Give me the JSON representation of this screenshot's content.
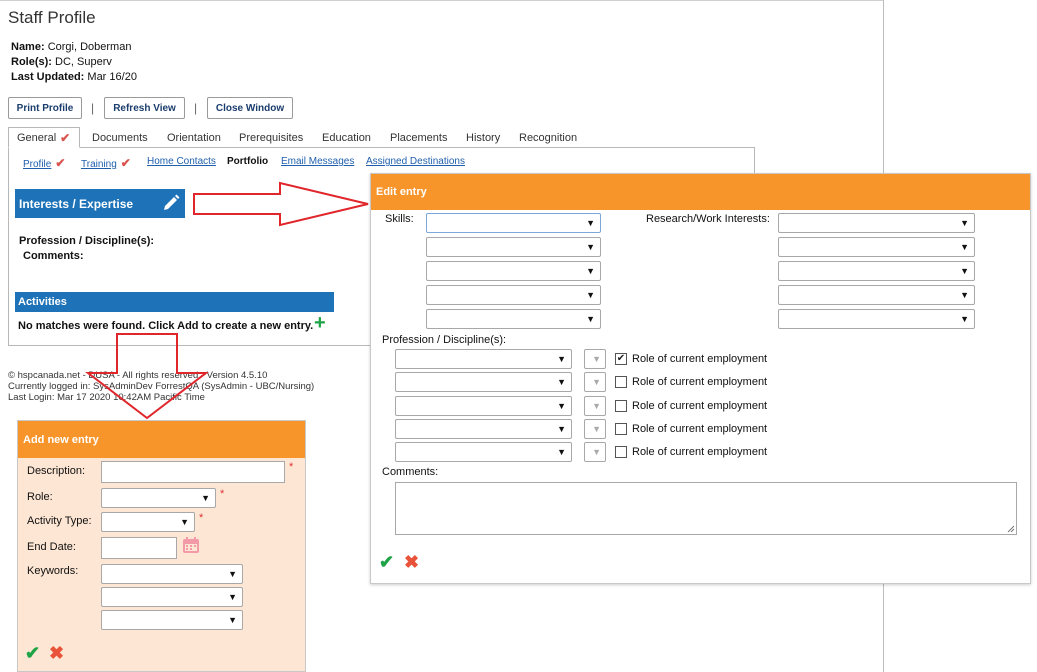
{
  "page": {
    "title": "Staff Profile",
    "name_label": "Name:",
    "name_value": "Corgi, Doberman",
    "roles_label": "Role(s):",
    "roles_value": "DC, Superv",
    "updated_label": "Last Updated:",
    "updated_value": "Mar 16/20"
  },
  "toolbar": {
    "print_label": "Print Profile",
    "refresh_label": "Refresh View",
    "close_label": "Close Window",
    "separator": "|"
  },
  "tabs": [
    {
      "label": "General",
      "checked": true
    },
    {
      "label": "Documents"
    },
    {
      "label": "Orientation"
    },
    {
      "label": "Prerequisites"
    },
    {
      "label": "Education"
    },
    {
      "label": "Placements"
    },
    {
      "label": "History"
    },
    {
      "label": "Recognition"
    }
  ],
  "subtabs": [
    {
      "label": "Profile",
      "checked": true
    },
    {
      "label": "Training",
      "checked": true
    },
    {
      "label": "Home Contacts"
    },
    {
      "label": "Portfolio"
    },
    {
      "label": "Email Messages"
    },
    {
      "label": "Assigned Destinations"
    }
  ],
  "check_glyph": "✔",
  "interests": {
    "header": "Interests / Expertise",
    "profession_label": "Profession / Discipline(s):",
    "comments_label": "Comments:"
  },
  "activities": {
    "header": "Activities",
    "empty_text": "No matches were found. Click Add to create a new entry.",
    "add_glyph": "+"
  },
  "footer": {
    "line1": "© hspcanada.net - DUSA - All rights reserved - Version 4.5.10",
    "line2": "Currently logged in: SysAdminDev ForrestQA (SysAdmin - UBC/Nursing)",
    "line3": "Last Login: Mar 17 2020 10:42AM Pacific Time"
  },
  "edit_entry": {
    "title": "Edit entry",
    "skills_label": "Skills:",
    "research_label": "Research/Work Interests:",
    "profession_label": "Profession / Discipline(s):",
    "role_label": "Role of current employment",
    "role_checked": [
      true,
      false,
      false,
      false,
      false
    ],
    "comments_label": "Comments:"
  },
  "add_entry": {
    "title": "Add new entry",
    "description_label": "Description:",
    "role_label": "Role:",
    "activity_type_label": "Activity Type:",
    "end_date_label": "End Date:",
    "keywords_label": "Keywords:",
    "required_mark": "*"
  },
  "icons": {
    "caret": "▼",
    "ok": "✔",
    "cancel": "✖"
  },
  "colors": {
    "accent_orange": "#f7952b",
    "header_blue": "#1d72b8",
    "arrow_red": "#e0262b",
    "add_bg": "#fde6d3"
  }
}
